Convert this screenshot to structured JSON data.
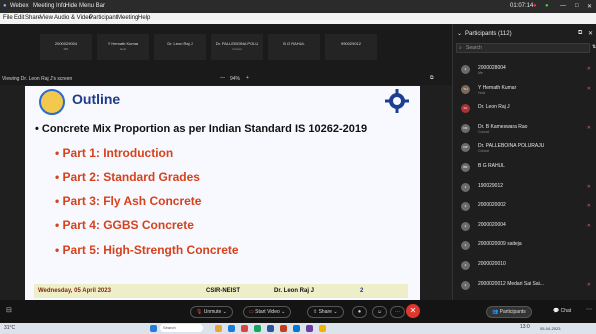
{
  "titlebar": {
    "app": "Webex",
    "meeting": "Meeting Info",
    "hide_menu": "Hide Menu Bar",
    "time": "01:07:14"
  },
  "menubar": [
    "File",
    "Edit",
    "Share",
    "View",
    "Audio & Video",
    "Participant",
    "Meeting",
    "Help"
  ],
  "strip": {
    "tiles": [
      {
        "name": "2000029004",
        "sub": "MR"
      },
      {
        "name": "Y Hemath Kumar",
        "sub": "Host"
      },
      {
        "name": "Dr. Leon Raj J",
        "sub": ""
      },
      {
        "name": "Dr. PALLEBOINA POLU",
        "sub": "Cohost"
      },
      {
        "name": "B G RAHUL",
        "sub": ""
      },
      {
        "name": "990029012",
        "sub": ""
      }
    ]
  },
  "share": {
    "viewing": "Viewing Dr. Leon Raj J's screen",
    "zoom": "94%"
  },
  "slide": {
    "title": "Outline",
    "main_bullet": "• Concrete Mix Proportion as per Indian Standard IS 10262-2019",
    "parts": [
      "• Part 1: Introduction",
      "• Part 2: Standard Grades",
      "• Part 3: Fly Ash Concrete",
      "• Part 4: GGBS Concrete",
      "• Part 5: High-Strength Concrete"
    ],
    "footer_date": "Wednesday, 05 April 2023",
    "footer_org": "CSIR-NEIST",
    "footer_name": "Dr. Leon Raj J",
    "footer_page": "2"
  },
  "participants": {
    "header": "Participants (112)",
    "search_placeholder": "Search",
    "list": [
      {
        "initials": "2",
        "name": "2000028004",
        "sub": "Me",
        "color": "#6b6b6b"
      },
      {
        "initials": "YH",
        "name": "Y Hemath Kumar",
        "sub": "Host",
        "color": "#7a6a5a"
      },
      {
        "initials": "DL",
        "name": "Dr. Leon Raj J",
        "sub": "",
        "color": "#a33"
      },
      {
        "initials": "DK",
        "name": "Dr. B Kameswara Rao",
        "sub": "Cohost",
        "color": "#6b6b6b"
      },
      {
        "initials": "DP",
        "name": "Dr. PALLEBOINA POLURAJU",
        "sub": "Cohost",
        "color": "#6b6b6b"
      },
      {
        "initials": "BR",
        "name": "B G RAHUL",
        "sub": "",
        "color": "#6b6b6b"
      },
      {
        "initials": "1",
        "name": "190029012",
        "sub": "",
        "color": "#6b6b6b"
      },
      {
        "initials": "2",
        "name": "2000020002",
        "sub": "",
        "color": "#6b6b6b"
      },
      {
        "initials": "2",
        "name": "2000020004",
        "sub": "",
        "color": "#6b6b6b"
      },
      {
        "initials": "2",
        "name": "2000020009 saiteja",
        "sub": "",
        "color": "#6b6b6b"
      },
      {
        "initials": "2",
        "name": "2000020010",
        "sub": "",
        "color": "#6b6b6b"
      },
      {
        "initials": "2",
        "name": "2000020012 Medari Sai Sai...",
        "sub": "",
        "color": "#6b6b6b"
      }
    ]
  },
  "toolbar": {
    "unmute": "Unmute",
    "start_video": "Start Video",
    "share": "Share",
    "participants_btn": "Participants",
    "chat_btn": "Chat"
  },
  "taskbar": {
    "weather": "31°C",
    "search": "Search",
    "time": "13:0",
    "date": "05-04-2023"
  }
}
